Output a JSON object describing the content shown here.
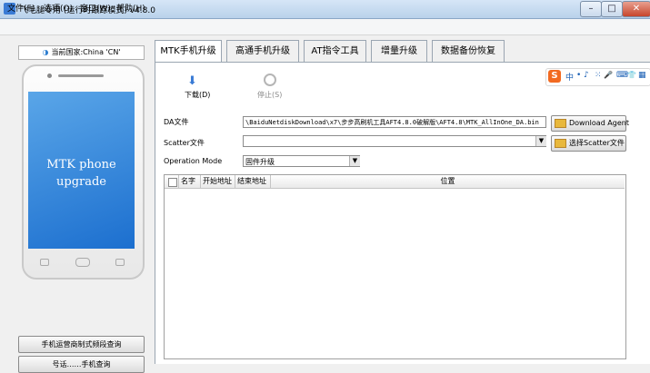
{
  "window": {
    "title": "飞毛腿专用     (运行时跟踪模式)  v4.8.0",
    "controls": {
      "minimize": "–",
      "maximize": "□",
      "close": "✕"
    }
  },
  "menu": [
    "文件(F)",
    "选项(O)",
    "窗口(W)",
    "帮助(H)"
  ],
  "left_panel": {
    "country": "当前国家:China 'CN'",
    "phone_label_line1": "MTK phone",
    "phone_label_line2": "upgrade",
    "buttons": [
      "手机运营商制式频段查询",
      "号话……手机查询"
    ]
  },
  "tabs": [
    "MTK手机升级",
    "高通手机升级",
    "AT指令工具",
    "增量升级",
    "数据备份恢复"
  ],
  "toolbar": {
    "download_label": "下载(D)",
    "stop_label": "停止(S)"
  },
  "ime": {
    "logo": "S",
    "items": [
      "中",
      "•",
      "♪",
      "⁙",
      "🎤",
      "⌨",
      "👕",
      "▦"
    ]
  },
  "form": {
    "da_label": "DA文件",
    "da_value": "\\BaiduNetdiskDownload\\x7\\步步高刷机工具AFT4.8.0破解版\\AFT4.8\\MTK_AllInOne_DA.bin",
    "da_button": "Download Agent",
    "scatter_label": "Scatter文件",
    "scatter_value": "",
    "scatter_button": "选择Scatter文件",
    "opmode_label": "Operation Mode",
    "opmode_value": "固件升级"
  },
  "table": {
    "columns": [
      "名字",
      "开始地址",
      "结束地址",
      "位置"
    ],
    "rows": []
  }
}
